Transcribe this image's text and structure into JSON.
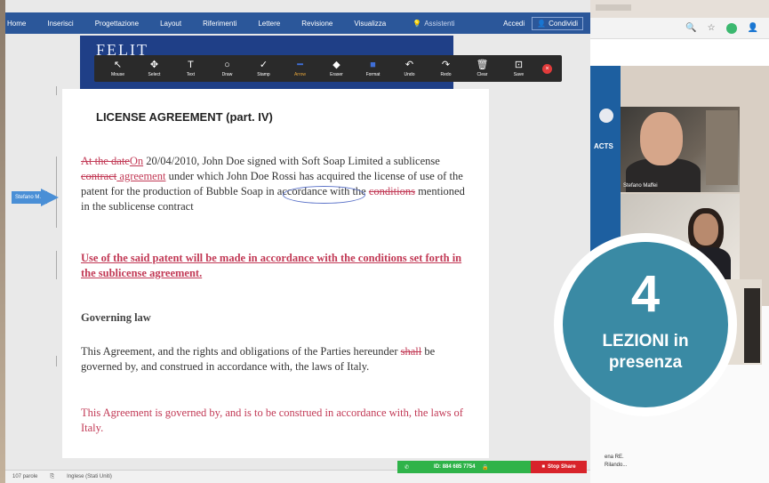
{
  "ribbon": {
    "tabs": [
      "Home",
      "Inserisci",
      "Progettazione",
      "Layout",
      "Riferimenti",
      "Lettere",
      "Revisione",
      "Visualizza"
    ],
    "search_placeholder": "Assistenti",
    "login": "Accedi",
    "share": "Condividi"
  },
  "banner": {
    "logo": "FELIT"
  },
  "annotation_toolbar": {
    "tools": [
      {
        "label": "Mouse",
        "icon": "cursor-icon",
        "glyph": "↖"
      },
      {
        "label": "Select",
        "icon": "select-icon",
        "glyph": "✥"
      },
      {
        "label": "Text",
        "icon": "text-icon",
        "glyph": "T"
      },
      {
        "label": "Draw",
        "icon": "draw-icon",
        "glyph": "○"
      },
      {
        "label": "Stamp",
        "icon": "stamp-icon",
        "glyph": "✓"
      },
      {
        "label": "Arrow",
        "icon": "arrow-icon",
        "glyph": "━"
      },
      {
        "label": "Eraser",
        "icon": "eraser-icon",
        "glyph": "◆"
      },
      {
        "label": "Format",
        "icon": "format-icon",
        "glyph": "■"
      },
      {
        "label": "Undo",
        "icon": "undo-icon",
        "glyph": "↶"
      },
      {
        "label": "Redo",
        "icon": "redo-icon",
        "glyph": "↷"
      },
      {
        "label": "Clear",
        "icon": "clear-icon",
        "glyph": "🗑"
      },
      {
        "label": "Save",
        "icon": "save-icon",
        "glyph": "⊡"
      }
    ],
    "accent": "#3f6fd8"
  },
  "document": {
    "title": "LICENSE AGREEMENT (part. IV)",
    "p1": {
      "deleted_1": "At the date",
      "inserted_1": "On",
      "text_1": " 20/04/2010, John Doe signed with Soft Soap Limited a sublicense ",
      "deleted_2": "contract",
      "inserted_2": " agreement",
      "text_2": " under which John Doe Rossi has acquired the license of use of the patent for the production of Bubble Soap in accordance with the ",
      "deleted_3": "conditions",
      "text_3": " mentioned in the sublicense contract"
    },
    "p2": "Use of the said patent will be made in accordance with the conditions set forth in the sublicense agreement.",
    "p3": "Governing law",
    "p4": {
      "text_1": "This Agreement, and the rights and obligations of the Parties hereunder ",
      "deleted": "shall",
      "text_2": " be governed by, and construed in accordance with, the laws of Italy."
    },
    "p5": "This Agreement is governed by, and is to be construed in accordance with, the laws of Italy.",
    "revision_color": "#c23a56"
  },
  "pointer_label": "Stefano M...",
  "statusbar": {
    "words": "107 parole",
    "language": "Inglese (Stati Uniti)"
  },
  "meeting": {
    "id": "ID: 884 685 7754",
    "stop_share": "Stop Share"
  },
  "participants": {
    "p1_name": "Stefano Maffei"
  },
  "sidenav_text": "ACTS",
  "chat_lines": [
    "ena RE.",
    "Rilando..."
  ],
  "promo": {
    "number": "4",
    "line1": "LEZIONI in",
    "line2": "presenza",
    "color": "#3a8aa4"
  }
}
